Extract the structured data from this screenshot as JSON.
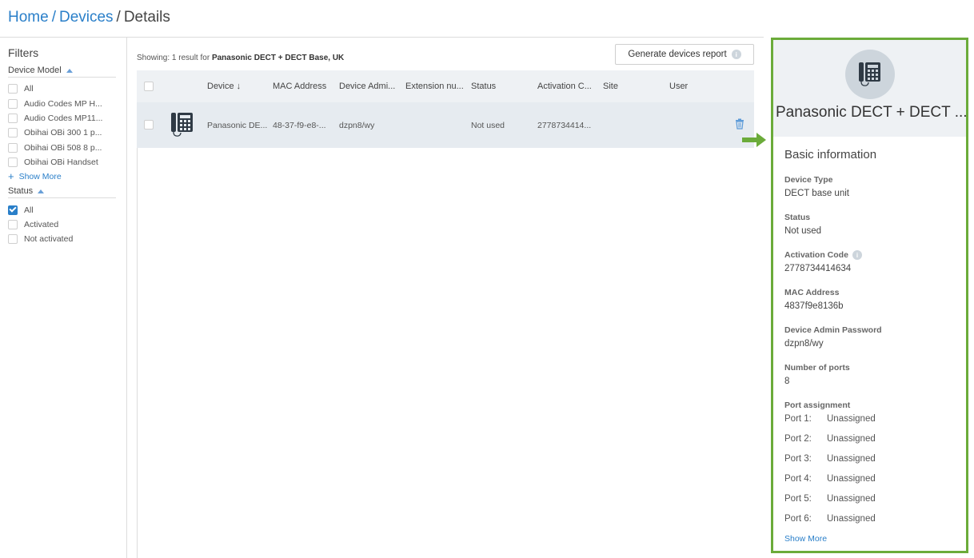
{
  "breadcrumb": {
    "home": "Home",
    "devices": "Devices",
    "current": "Details",
    "sep": "/"
  },
  "filters": {
    "title": "Filters",
    "device_model": {
      "title": "Device Model",
      "items": [
        {
          "label": "All",
          "checked": false
        },
        {
          "label": "Audio Codes MP H...",
          "checked": false
        },
        {
          "label": "Audio Codes MP11...",
          "checked": false
        },
        {
          "label": "Obihai OBi 300 1 p...",
          "checked": false
        },
        {
          "label": "Obihai OBi 508 8 p...",
          "checked": false
        },
        {
          "label": "Obihai OBi Handset",
          "checked": false
        }
      ],
      "show_more": "Show More"
    },
    "status": {
      "title": "Status",
      "items": [
        {
          "label": "All",
          "checked": true
        },
        {
          "label": "Activated",
          "checked": false
        },
        {
          "label": "Not activated",
          "checked": false
        }
      ]
    }
  },
  "results": {
    "prefix": "Showing: 1 result for",
    "query": "Panasonic DECT + DECT Base, UK",
    "report_button": "Generate devices report"
  },
  "table": {
    "headers": {
      "device": "Device ↓",
      "mac": "MAC Address",
      "admin": "Device Admi...",
      "extension": "Extension nu...",
      "status": "Status",
      "activation": "Activation C...",
      "site": "Site",
      "user": "User"
    },
    "row": {
      "device": "Panasonic DE...",
      "mac": "48-37-f9-e8-...",
      "admin": "dzpn8/wy",
      "extension": "",
      "status": "Not used",
      "activation": "2778734414...",
      "site": "",
      "user": ""
    }
  },
  "panel": {
    "title": "Panasonic DECT + DECT ...",
    "section": "Basic information",
    "fields": {
      "device_type_label": "Device Type",
      "device_type": "DECT base unit",
      "status_label": "Status",
      "status": "Not used",
      "activation_label": "Activation Code",
      "activation": "2778734414634",
      "mac_label": "MAC Address",
      "mac": "4837f9e8136b",
      "admin_label": "Device Admin Password",
      "admin": "dzpn8/wy",
      "ports_label": "Number of ports",
      "ports": "8",
      "port_assignment_label": "Port assignment"
    },
    "ports": [
      {
        "port": "Port 1:",
        "value": "Unassigned"
      },
      {
        "port": "Port 2:",
        "value": "Unassigned"
      },
      {
        "port": "Port 3:",
        "value": "Unassigned"
      },
      {
        "port": "Port 4:",
        "value": "Unassigned"
      },
      {
        "port": "Port 5:",
        "value": "Unassigned"
      },
      {
        "port": "Port 6:",
        "value": "Unassigned"
      }
    ],
    "show_more": "Show More"
  },
  "colors": {
    "accent": "#2a7fc9",
    "highlight": "#6bab3a",
    "row_bg": "#e6ebf0"
  }
}
